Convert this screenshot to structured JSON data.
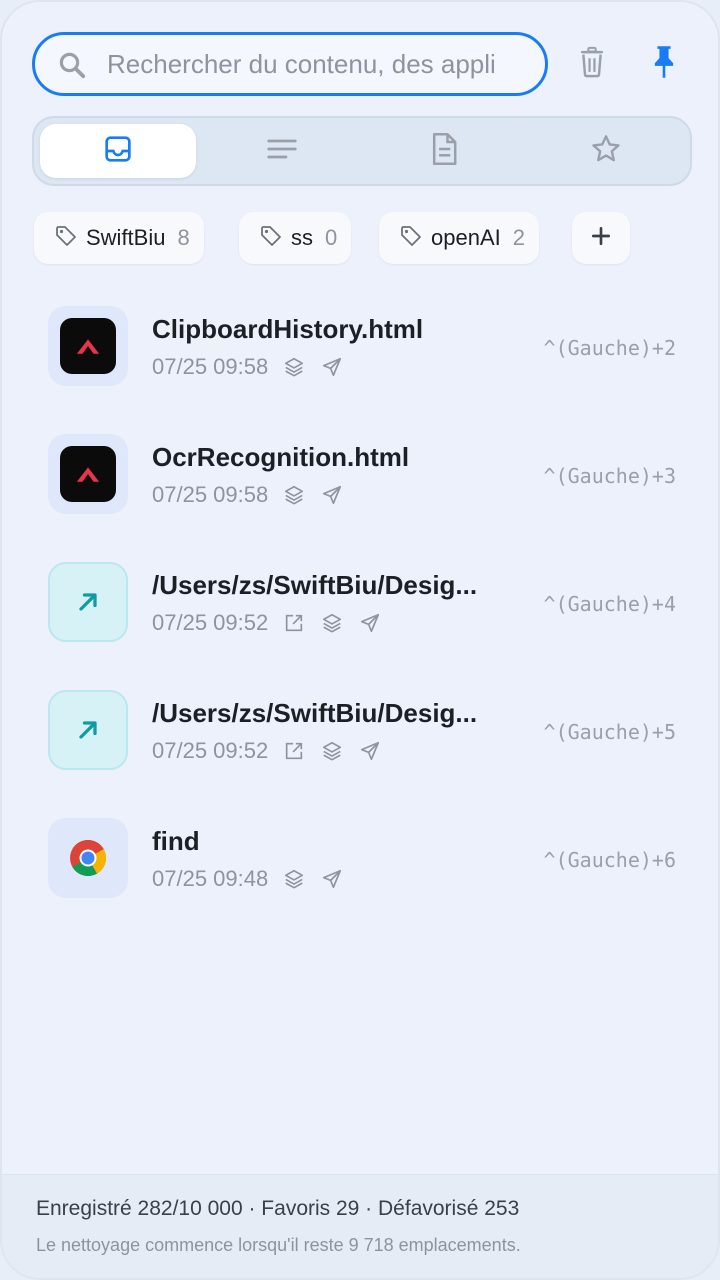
{
  "search": {
    "placeholder": "Rechercher du contenu, des appli",
    "value": ""
  },
  "tags": [
    {
      "name": "SwiftBiu",
      "count": "8"
    },
    {
      "name": "ss",
      "count": "0"
    },
    {
      "name": "openAI",
      "count": "2"
    }
  ],
  "items": [
    {
      "title": "ClipboardHistory.html",
      "time": "07/25 09:58",
      "shortcut": "^(Gauche)+2"
    },
    {
      "title": "OcrRecognition.html",
      "time": "07/25 09:58",
      "shortcut": "^(Gauche)+3"
    },
    {
      "title": "/Users/zs/SwiftBiu/Desig...",
      "time": "07/25 09:52",
      "shortcut": "^(Gauche)+4"
    },
    {
      "title": "/Users/zs/SwiftBiu/Desig...",
      "time": "07/25 09:52",
      "shortcut": "^(Gauche)+5"
    },
    {
      "title": "find",
      "time": "07/25 09:48",
      "shortcut": "^(Gauche)+6"
    }
  ],
  "footer": {
    "stats": "Enregistré 282/10 000 · Favoris 29 · Défavorisé 253",
    "note": "Le nettoyage commence lorsqu'il reste 9 718 emplacements."
  },
  "colors": {
    "accent": "#1a7cf5",
    "muted": "#8e939d",
    "shortcut_accent": "#e8344a",
    "link_teal": "#0f9aa8"
  },
  "icons": {
    "search": "search-icon",
    "trash": "trash-icon",
    "pin": "pin-icon",
    "tabs": [
      "inbox-icon",
      "lines-icon",
      "document-icon",
      "star-icon"
    ],
    "tag": "tag-icon",
    "add": "plus-icon",
    "app": [
      "app-logo-icon",
      "app-logo-icon",
      "link-arrow-icon",
      "link-arrow-icon",
      "chrome-icon"
    ],
    "meta": [
      "layers-icon",
      "send-icon",
      "open-external-icon"
    ]
  }
}
